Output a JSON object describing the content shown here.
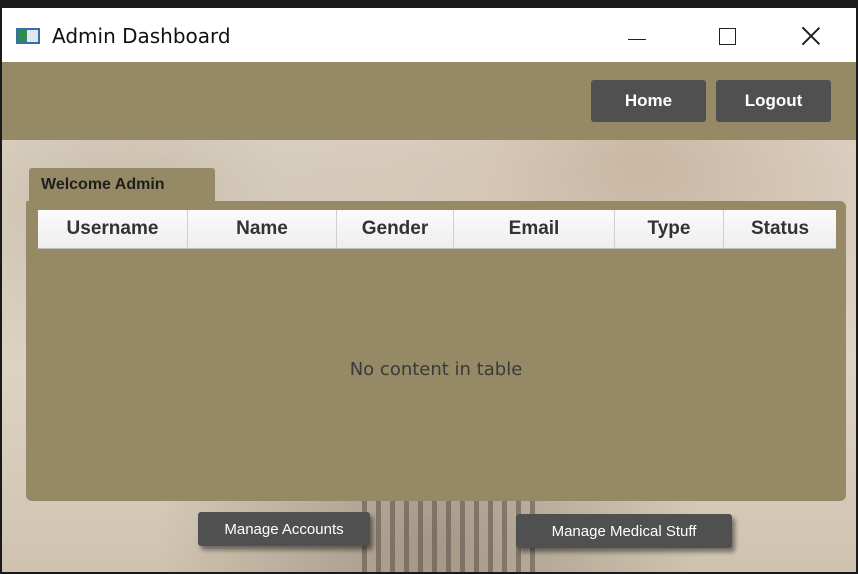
{
  "window": {
    "title": "Admin Dashboard"
  },
  "header": {
    "home_label": "Home",
    "logout_label": "Logout"
  },
  "tab": {
    "label": "Welcome Admin"
  },
  "table": {
    "columns": [
      "Username",
      "Name",
      "Gender",
      "Email",
      "Type",
      "Status"
    ],
    "rows": [],
    "empty_message": "No content in table"
  },
  "actions": {
    "manage_accounts_label": "Manage Accounts",
    "manage_medical_label": "Manage Medical Stuff"
  },
  "colors": {
    "panel": "#958a65",
    "button": "#505050"
  }
}
